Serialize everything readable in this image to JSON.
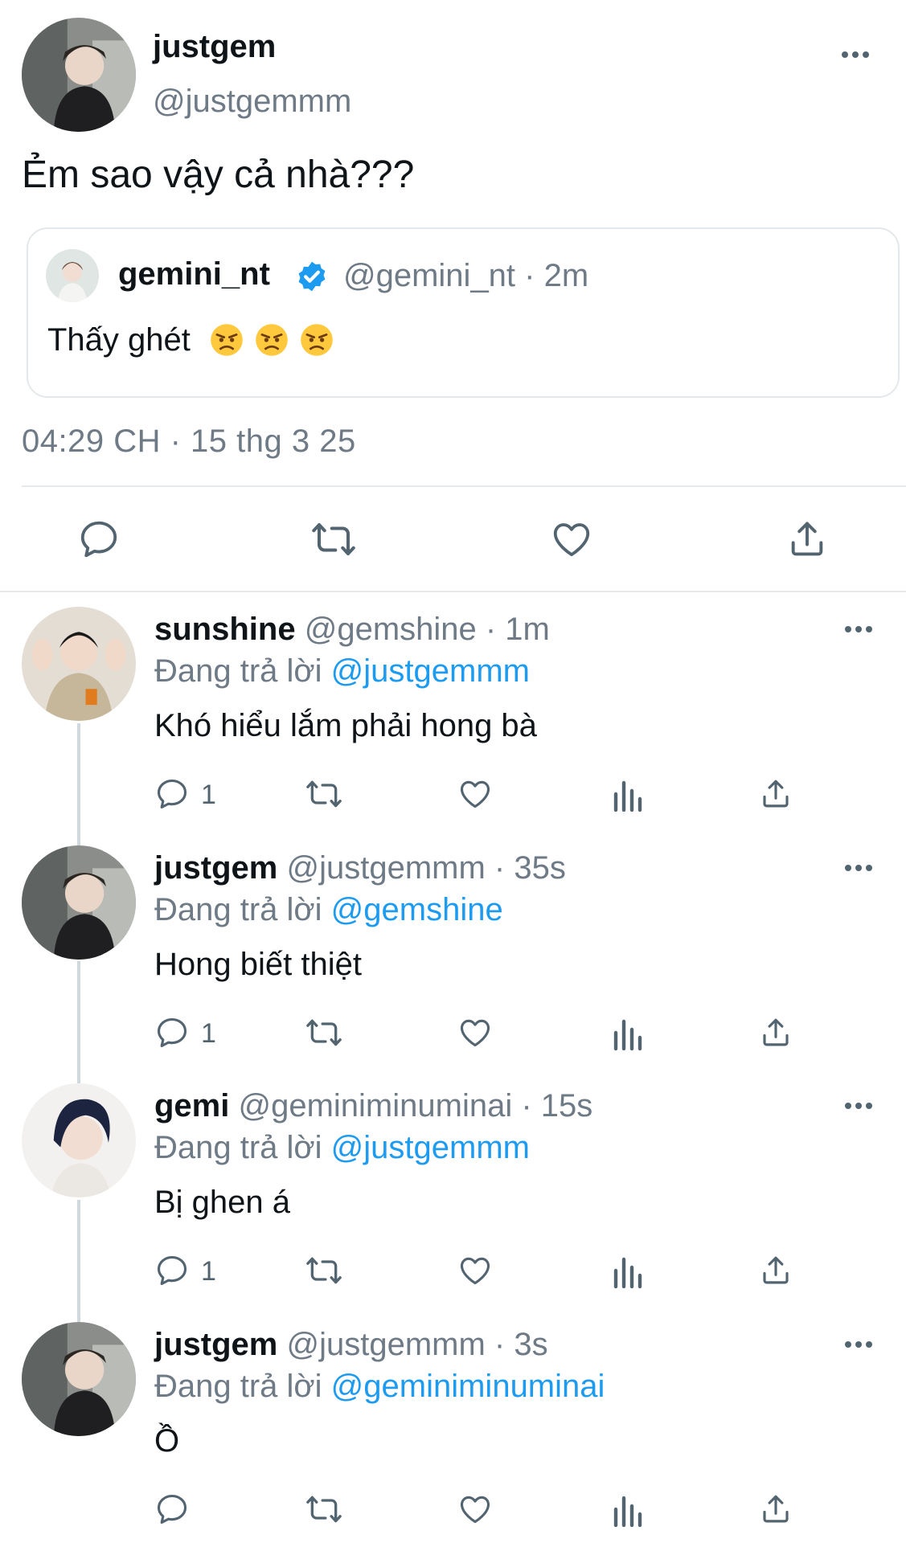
{
  "main": {
    "name": "justgem",
    "handle": "@justgemmm",
    "text": "Ẻm sao vậy cả nhà???",
    "timestamp": "04:29 CH · 15 thg 3 25",
    "icons": [
      "reply-icon",
      "retweet-icon",
      "like-icon",
      "share-icon"
    ]
  },
  "quote": {
    "name": "gemini_nt",
    "meta": "@gemini_nt · 2m",
    "text": "Thấy ghét",
    "emojis": [
      "angry-face-icon",
      "angry-face-icon",
      "angry-face-icon"
    ],
    "verified_color": "#1d9bf0"
  },
  "colors": {
    "text": "#0f1419",
    "secondary": "#6e7a86",
    "link": "#1d9bf0",
    "divider": "#e7eaed"
  },
  "replies": [
    {
      "name": "sunshine",
      "meta": "@gemshine · 1m",
      "replying_prefix": "Đang trả lời",
      "replying_to": "@justgemmm",
      "text": "Khó hiểu lắm phải hong bà",
      "reply_count": "1"
    },
    {
      "name": "justgem",
      "meta": "@justgemmm · 35s",
      "replying_prefix": "Đang trả lời",
      "replying_to": "@gemshine",
      "text": "Hong biết thiệt",
      "reply_count": "1"
    },
    {
      "name": "gemi",
      "meta": "@geminiminuminai · 15s",
      "replying_prefix": "Đang trả lời",
      "replying_to": "@justgemmm",
      "text": "Bị ghen á",
      "reply_count": "1"
    },
    {
      "name": "justgem",
      "meta": "@justgemmm · 3s",
      "replying_prefix": "Đang trả lời",
      "replying_to": "@geminiminuminai",
      "text": "Ồ",
      "reply_count": ""
    }
  ]
}
